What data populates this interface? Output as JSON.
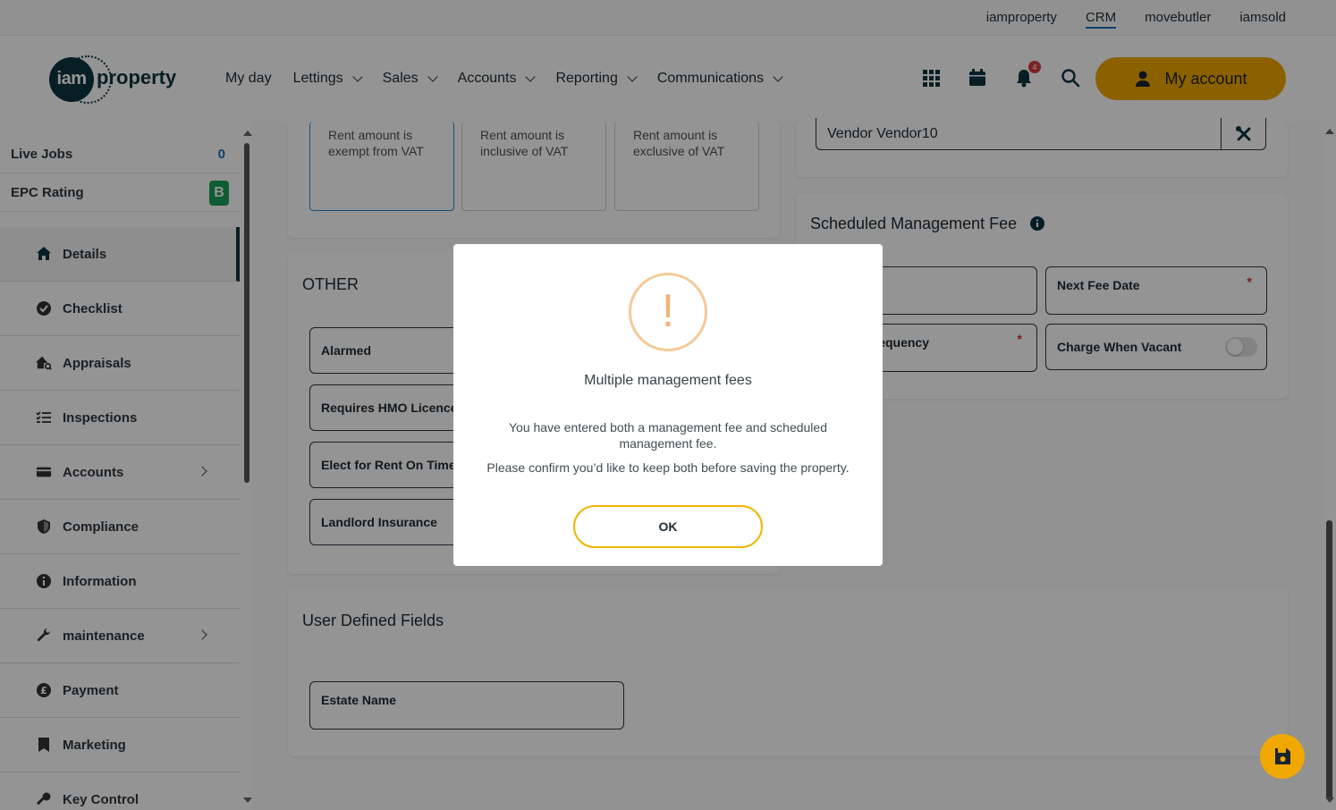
{
  "top_links": [
    "iamproperty",
    "CRM",
    "movebutler",
    "iamsold"
  ],
  "logo": {
    "left": "iam",
    "right": "property"
  },
  "nav": {
    "items": [
      {
        "label": "My day",
        "dropdown": false
      },
      {
        "label": "Lettings",
        "dropdown": true
      },
      {
        "label": "Sales",
        "dropdown": true
      },
      {
        "label": "Accounts",
        "dropdown": true
      },
      {
        "label": "Reporting",
        "dropdown": true
      },
      {
        "label": "Communications",
        "dropdown": true
      }
    ],
    "notification_count": "4",
    "my_account_label": "My account",
    "accent_color": "#f0a800"
  },
  "sidebar": {
    "live_jobs_label": "Live Jobs",
    "live_jobs_count": "0",
    "epc_label": "EPC Rating",
    "epc_value": "B",
    "items": [
      {
        "label": "Details",
        "icon": "home-icon",
        "active": true
      },
      {
        "label": "Checklist",
        "icon": "check-circle-icon"
      },
      {
        "label": "Appraisals",
        "icon": "house-search-icon"
      },
      {
        "label": "Inspections",
        "icon": "list-check-icon"
      },
      {
        "label": "Accounts",
        "icon": "card-icon",
        "submenu": true
      },
      {
        "label": "Compliance",
        "icon": "shield-icon"
      },
      {
        "label": "Information",
        "icon": "info-icon"
      },
      {
        "label": "maintenance",
        "icon": "wrench-icon",
        "submenu": true
      },
      {
        "label": "Payment",
        "icon": "pound-icon"
      },
      {
        "label": "Marketing",
        "icon": "bookmark-icon"
      },
      {
        "label": "Key Control",
        "icon": "key-icon"
      }
    ]
  },
  "vat_options": [
    {
      "label": "Rent amount is exempt from VAT",
      "selected": true
    },
    {
      "label": "Rent amount is inclusive of VAT"
    },
    {
      "label": "Rent amount is exclusive of VAT"
    }
  ],
  "vendor": {
    "value": "Vendor Vendor10"
  },
  "other": {
    "title": "OTHER",
    "fields": [
      "Alarmed",
      "Requires HMO Licence",
      "Elect for Rent On Time",
      "Landlord Insurance"
    ]
  },
  "scheduled_fee": {
    "title": "Scheduled Management Fee",
    "next_fee_date_label": "Next Fee Date",
    "frequency_label_partial": "equency",
    "charge_when_vacant_label": "Charge When Vacant",
    "required_mark": "*"
  },
  "user_defined": {
    "title": "User Defined Fields",
    "estate_name_label": "Estate Name"
  },
  "modal": {
    "icon_glyph": "!",
    "title": "Multiple management fees",
    "text1": "You have entered both a management fee and scheduled management fee.",
    "text2": "Please confirm you’d like to keep both before saving the property.",
    "ok_label": "OK"
  }
}
